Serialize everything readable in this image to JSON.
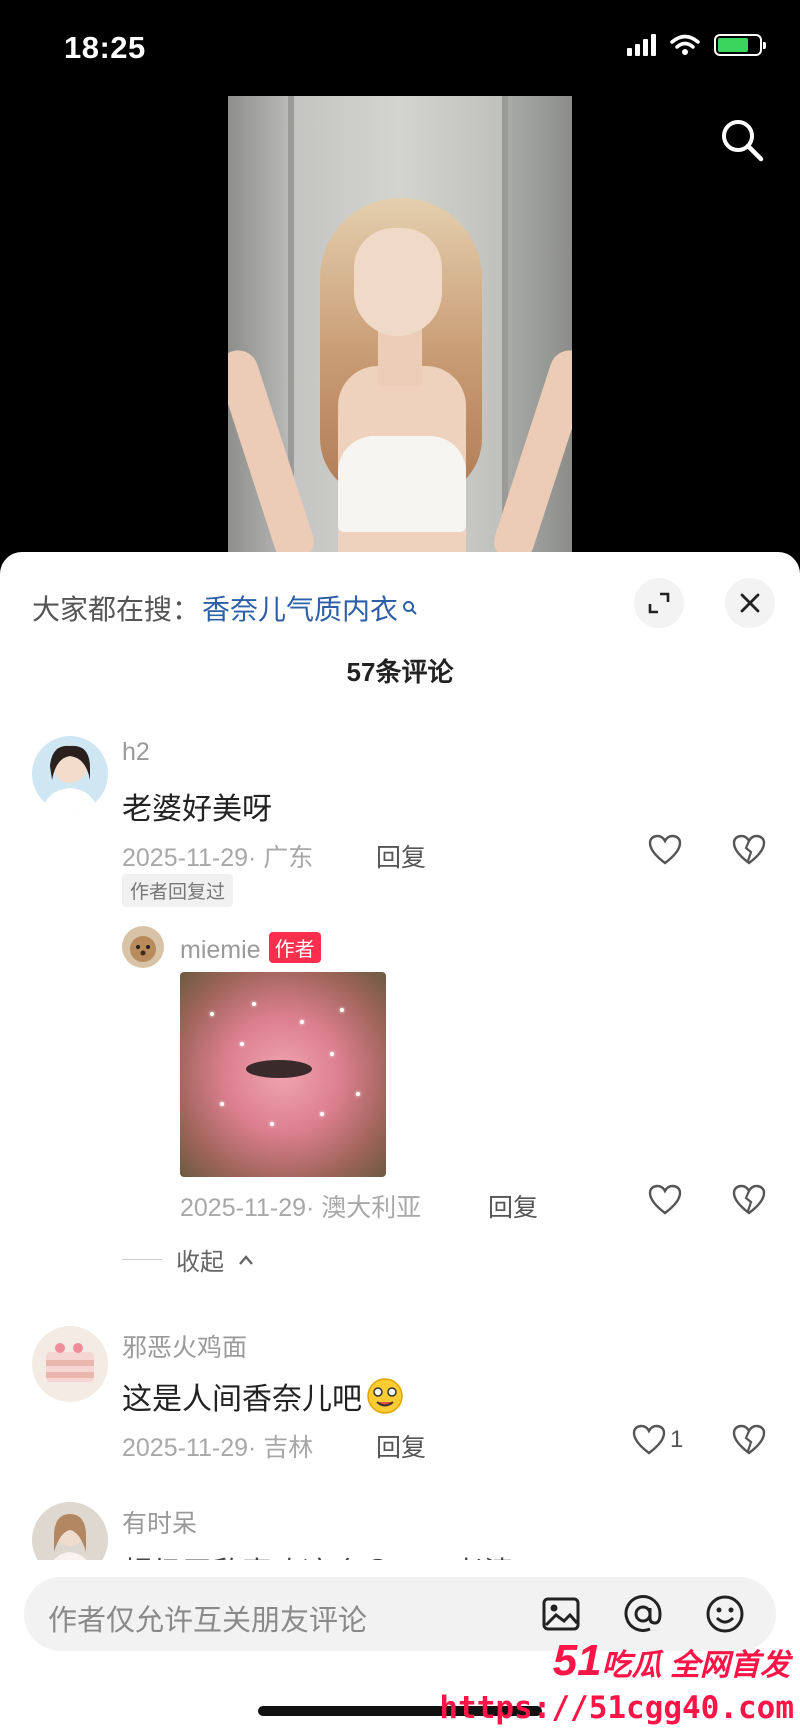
{
  "status_bar": {
    "time": "18:25",
    "battery_level": 0.75
  },
  "sheet": {
    "hot_search_prefix": "大家都在搜：",
    "hot_search_keyword": "香奈儿气质内衣",
    "comment_count_title": "57条评论"
  },
  "comments": [
    {
      "username": "h2",
      "text": "老婆好美呀",
      "date_location": "2025-11-29· 广东",
      "reply_label": "回复",
      "tag": "作者回复过",
      "replies": [
        {
          "username": "miemie",
          "badge": "作者",
          "date_location": "2025-11-29· 澳大利亚",
          "reply_label": "回复"
        }
      ],
      "collapse_label": "收起"
    },
    {
      "username": "邪恶火鸡面",
      "text": "这是人间香奈儿吧",
      "date_location": "2025-11-29· 吉林",
      "reply_label": "回复",
      "like_count": "1"
    },
    {
      "username": "有时呆",
      "text": "超级无敌喜欢这个😊……老婆"
    }
  ],
  "input_bar": {
    "placeholder": "作者仅允许互关朋友评论"
  },
  "watermark": {
    "brand_num": "51",
    "brand_text": "吃瓜 全网首发",
    "url": "https://51cgg40.com"
  },
  "colors": {
    "keyword": "#2d5fa8",
    "author_badge": "#ff2e4d",
    "watermark": "#ff1447"
  },
  "icons": [
    "search-icon",
    "expand-icon",
    "close-icon",
    "heart-icon",
    "broken-heart-icon",
    "image-icon",
    "at-icon",
    "emoji-icon"
  ]
}
